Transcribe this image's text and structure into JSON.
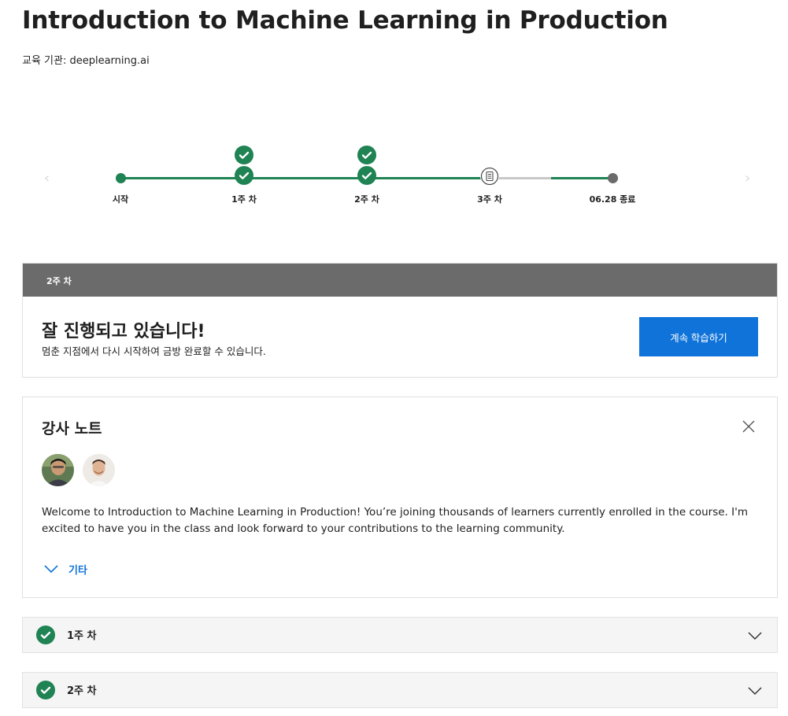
{
  "course": {
    "title": "Introduction to Machine Learning in Production",
    "provider": "교육 기관: deeplearning.ai"
  },
  "timeline": {
    "start_label": "시작",
    "week1_label": "1주 차",
    "week2_label": "2주 차",
    "week3_label": "3주 차",
    "end_label": "06.28 종료",
    "colors": {
      "done": "#1f8354",
      "pending": "#c8c8c8",
      "end": "#6b6b6b"
    }
  },
  "current_week": {
    "header": "2주 차",
    "title": "잘 진행되고 있습니다!",
    "subtitle": "멈춘 지점에서 다시 시작하여 금방 완료할 수 있습니다.",
    "resume_label": "계속 학습하기"
  },
  "instructor_notes": {
    "title": "강사 노트",
    "body": "Welcome to Introduction to Machine Learning in Production! You’re joining thousands of learners currently enrolled in the course. I'm excited to have you in the class and look forward to your contributions to the learning community.",
    "more_label": "기타"
  },
  "weeks": [
    {
      "label": "1주 차",
      "status": "complete"
    },
    {
      "label": "2주 차",
      "status": "complete"
    }
  ],
  "icons": {
    "check": "check-icon",
    "reading": "reading-icon",
    "close": "close-icon",
    "chevron": "chevron-down-icon"
  }
}
